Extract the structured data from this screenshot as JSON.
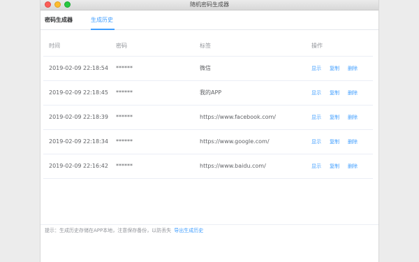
{
  "window": {
    "title": "随机密码生成器"
  },
  "tabs": [
    {
      "label": "密码生成器"
    },
    {
      "label": "生成历史"
    }
  ],
  "table": {
    "headers": {
      "time": "时间",
      "password": "密码",
      "tag": "标签",
      "actions": "操作"
    },
    "rows": [
      {
        "time": "2019-02-09 22:18:54",
        "password": "******",
        "tag": "微信"
      },
      {
        "time": "2019-02-09 22:18:45",
        "password": "******",
        "tag": "我的APP"
      },
      {
        "time": "2019-02-09 22:18:39",
        "password": "******",
        "tag": "https://www.facebook.com/"
      },
      {
        "time": "2019-02-09 22:18:34",
        "password": "******",
        "tag": "https://www.google.com/"
      },
      {
        "time": "2019-02-09 22:16:42",
        "password": "******",
        "tag": "https://www.baidu.com/"
      }
    ],
    "actions": {
      "show": "显示",
      "copy": "复制",
      "delete": "删除"
    }
  },
  "footer": {
    "hint": "提示：生成历史存储在APP本地，注意保存备份，以防丢失",
    "export_link": "导出生成历史"
  },
  "colors": {
    "accent": "#409eff"
  }
}
